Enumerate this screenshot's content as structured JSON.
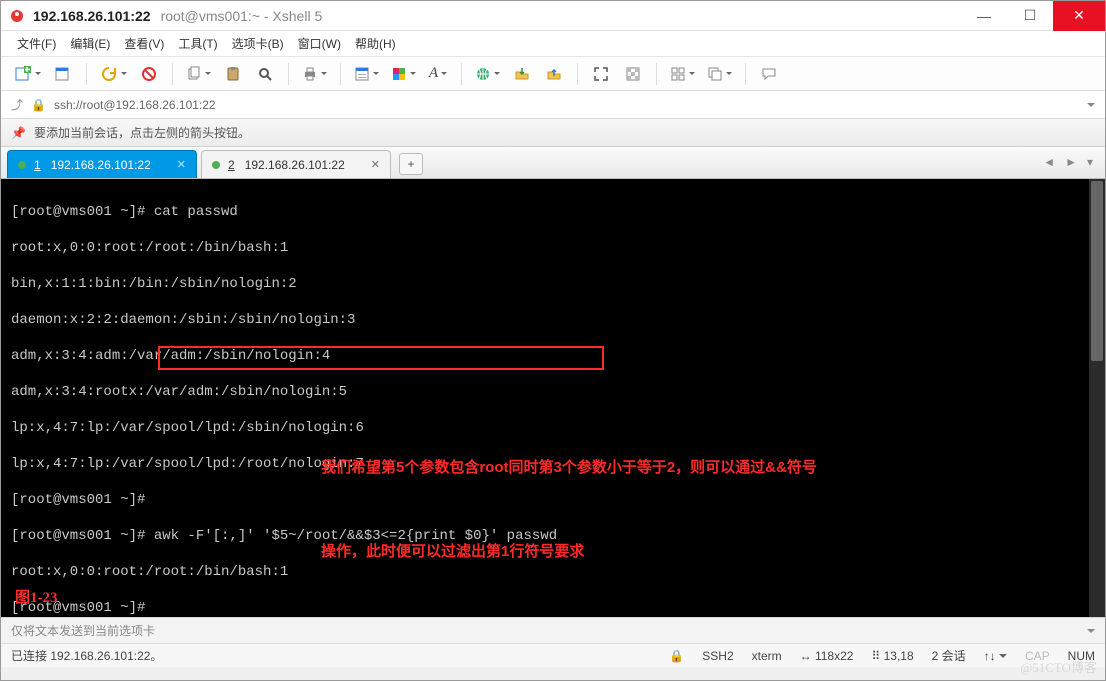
{
  "window": {
    "title_main": "192.168.26.101:22",
    "title_sub": "root@vms001:~ - Xshell 5"
  },
  "menu": {
    "file": "文件(F)",
    "edit": "编辑(E)",
    "view": "查看(V)",
    "tools": "工具(T)",
    "tabs": "选项卡(B)",
    "window": "窗口(W)",
    "help": "帮助(H)"
  },
  "toolbar_icons": {
    "new_session": "new-session-icon",
    "open": "open-icon",
    "reconnect": "reconnect-icon",
    "disconnect": "disconnect-icon",
    "copy": "copy-icon",
    "paste": "paste-icon",
    "find": "find-icon",
    "print": "print-icon",
    "properties": "properties-icon",
    "color": "color-icon",
    "font": "font-icon",
    "web": "web-icon",
    "transfer": "transfer-icon",
    "start_tunnel": "tunnel-icon",
    "fullscreen": "fullscreen-icon",
    "tile": "tile-icon",
    "cascade": "cascade-icon",
    "chat": "chat-icon"
  },
  "address": {
    "url": "ssh://root@192.168.26.101:22"
  },
  "tipbar": {
    "text": "要添加当前会话，点击左侧的箭头按钮。"
  },
  "tabs": {
    "items": [
      {
        "num": "1",
        "label": "192.168.26.101:22",
        "active": true
      },
      {
        "num": "2",
        "label": "192.168.26.101:22",
        "active": false
      }
    ]
  },
  "terminal": {
    "lines": [
      "[root@vms001 ~]# cat passwd",
      "root:x,0:0:root:/root:/bin/bash:1",
      "bin,x:1:1:bin:/bin:/sbin/nologin:2",
      "daemon:x:2:2:daemon:/sbin:/sbin/nologin:3",
      "adm,x:3:4:adm:/var/adm:/sbin/nologin:4",
      "adm,x:3:4:rootx:/var/adm:/sbin/nologin:5",
      "lp:x,4:7:lp:/var/spool/lpd:/sbin/nologin:6",
      "lp:x,4:7:lp:/var/spool/lpd:/root/nologin:7",
      "[root@vms001 ~]#",
      "[root@vms001 ~]# awk -F'[:,]' '$5~/root/&&$3<=2{print $0}' passwd",
      "root:x,0:0:root:/root:/bin/bash:1",
      "[root@vms001 ~]#",
      "[root@vms001 ~]# "
    ],
    "annotation_line1": "我们希望第5个参数包含root同时第3个参数小于等于2，则可以通过&&符号",
    "annotation_line2": "操作，此时便可以过滤出第1行符号要求",
    "figure_label": "图1-23"
  },
  "footer": {
    "placeholder": "仅将文本发送到当前选项卡"
  },
  "status": {
    "connection": "已连接 192.168.26.101:22。",
    "protocol": "SSH2",
    "term": "xterm",
    "size": "118x22",
    "cursor": "13,18",
    "sessions": "2 会话",
    "sessions_icon": "↑↓",
    "size_icon": "↔",
    "cursor_icon": "⠿",
    "cap": "CAP",
    "num": "NUM"
  },
  "watermark": "@51CTO博客"
}
